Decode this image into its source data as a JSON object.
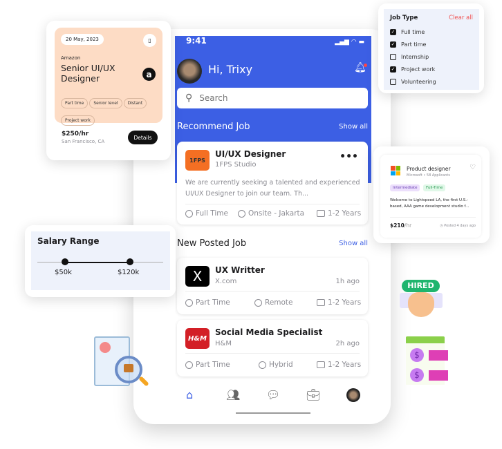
{
  "phone": {
    "status_time": "9:41",
    "greeting": "Hi, Trixy",
    "search_placeholder": "Search",
    "recommend": {
      "title": "Recommend Job",
      "show_all": "Show all",
      "job": {
        "logo_text": "1FPS",
        "title": "UI/UX Designer",
        "company": "1FPS Studio",
        "description": "We are currently seeking a talented and experienced UI/UX Designer to join our team. Th...",
        "type": "Full Time",
        "location": "Onsite - Jakarta",
        "experience": "1-2 Years",
        "logo_color": "#f46f23"
      }
    },
    "new_posted": {
      "title": "New Posted Job",
      "show_all": "Show all",
      "jobs": [
        {
          "logo_text": "X",
          "title": "UX Writter",
          "company": "X.com",
          "posted": "1h ago",
          "type": "Part Time",
          "location": "Remote",
          "experience": "1-2 Years",
          "logo_color": "#000000"
        },
        {
          "logo_text": "H&M",
          "title": "Social Media Specialist",
          "company": "H&M",
          "posted": "2h ago",
          "type": "Part Time",
          "location": "Hybrid",
          "experience": "1-2 Years",
          "logo_color": "#d31f26"
        }
      ]
    },
    "bottom_nav": [
      "home",
      "people",
      "chat",
      "briefcase",
      "profile"
    ],
    "accent": "#3c5fe4"
  },
  "amazon_card": {
    "date": "20 May, 2023",
    "company": "Amazon",
    "title": "Senior UI/UX Designer",
    "tags": [
      "Part time",
      "Senior level",
      "Distant",
      "Project work"
    ],
    "rate": "$250/hr",
    "location": "San Francisco, CA",
    "details_button": "Details",
    "bg": "#fddcc5"
  },
  "salary": {
    "title": "Salary Range",
    "min": "$50k",
    "max": "$120k"
  },
  "job_type": {
    "title": "Job Type",
    "clear_all": "Clear all",
    "options": [
      {
        "label": "Full time",
        "checked": true
      },
      {
        "label": "Part time",
        "checked": true
      },
      {
        "label": "Internship",
        "checked": false
      },
      {
        "label": "Project work",
        "checked": true
      },
      {
        "label": "Volunteering",
        "checked": false
      }
    ]
  },
  "product_card": {
    "title": "Product designer",
    "subtitle": "Microsoft • 58 Applicants",
    "tags": [
      "Intermediate",
      "Full-Time"
    ],
    "description": "Welcome to Lightspeed LA, the first U.S.-based, AAA game development studio f...",
    "rate": "$210",
    "rate_unit": "/hr",
    "posted": "Posted 4 days ago"
  },
  "illustrations": {
    "hired_badge": "HIRED"
  }
}
